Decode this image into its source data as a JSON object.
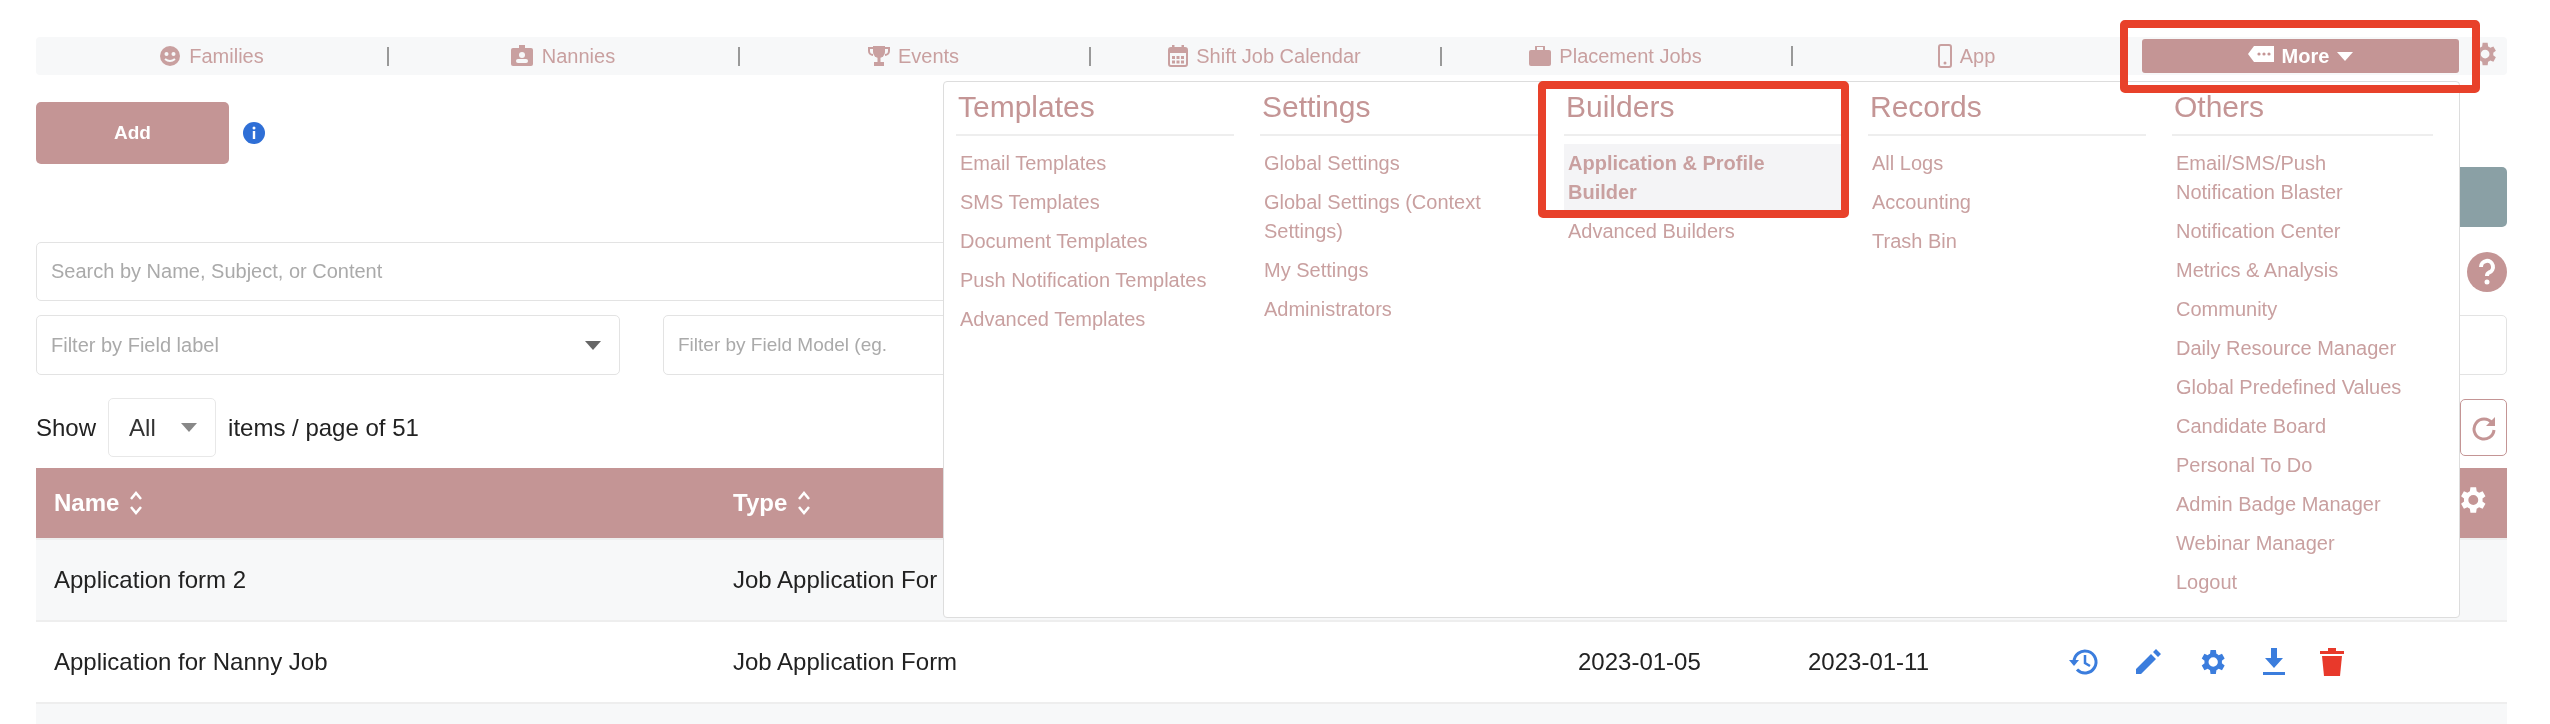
{
  "nav": {
    "items": [
      {
        "label": "Families"
      },
      {
        "label": "Nannies"
      },
      {
        "label": "Events"
      },
      {
        "label": "Shift Job Calendar"
      },
      {
        "label": "Placement Jobs"
      },
      {
        "label": "App"
      }
    ],
    "more": {
      "label": "More",
      "expanded": true
    }
  },
  "add_button": "Add",
  "search": {
    "placeholder": "Search by Name, Subject, or Content"
  },
  "filters": [
    {
      "kind": "select",
      "placeholder": "Filter by Field label"
    },
    {
      "kind": "input",
      "placeholder": "Filter by Field Model (eg."
    },
    {
      "kind": "select"
    }
  ],
  "pagination": {
    "show_label": "Show",
    "page_size": "All",
    "suffix": "items / page of 51"
  },
  "table": {
    "columns": [
      "Name",
      "Type"
    ],
    "rows": [
      {
        "cells": [
          "Application form 2",
          "Job Application For"
        ]
      },
      {
        "cells": [
          "Application for Nanny Job",
          "Job Application Form",
          "2023-01-05",
          "2023-01-11"
        ]
      }
    ]
  },
  "more_menu": {
    "groups": [
      {
        "title": "Templates",
        "items": [
          {
            "label": "Email Templates",
            "selected": false
          },
          {
            "label": "SMS Templates",
            "selected": false
          },
          {
            "label": "Document Templates",
            "selected": false
          },
          {
            "label": "Push Notification Templates",
            "selected": false
          },
          {
            "label": "Advanced Templates",
            "selected": false
          }
        ]
      },
      {
        "title": "Settings",
        "items": [
          {
            "label": "Global Settings",
            "selected": false
          },
          {
            "label": "Global Settings (Context Settings)",
            "selected": false
          },
          {
            "label": "My Settings",
            "selected": false
          },
          {
            "label": "Administrators",
            "selected": false
          }
        ]
      },
      {
        "title": "Builders",
        "items": [
          {
            "label": "Application & Profile Builder",
            "selected": true
          },
          {
            "label": "Advanced Builders",
            "selected": false
          }
        ]
      },
      {
        "title": "Records",
        "items": [
          {
            "label": "All Logs",
            "selected": false
          },
          {
            "label": "Accounting",
            "selected": false
          },
          {
            "label": "Trash Bin",
            "selected": false
          }
        ]
      },
      {
        "title": "Others",
        "items": [
          {
            "label": "Email/SMS/Push Notification Blaster",
            "selected": false
          },
          {
            "label": "Notification Center",
            "selected": false
          },
          {
            "label": "Metrics & Analysis",
            "selected": false
          },
          {
            "label": "Community",
            "selected": false
          },
          {
            "label": "Daily Resource Manager",
            "selected": false
          },
          {
            "label": "Global Predefined Values",
            "selected": false
          },
          {
            "label": "Candidate Board",
            "selected": false
          },
          {
            "label": "Personal To Do",
            "selected": false
          },
          {
            "label": "Admin Badge Manager",
            "selected": false
          },
          {
            "label": "Webinar Manager",
            "selected": false
          },
          {
            "label": "Logout",
            "selected": false
          }
        ]
      }
    ]
  }
}
